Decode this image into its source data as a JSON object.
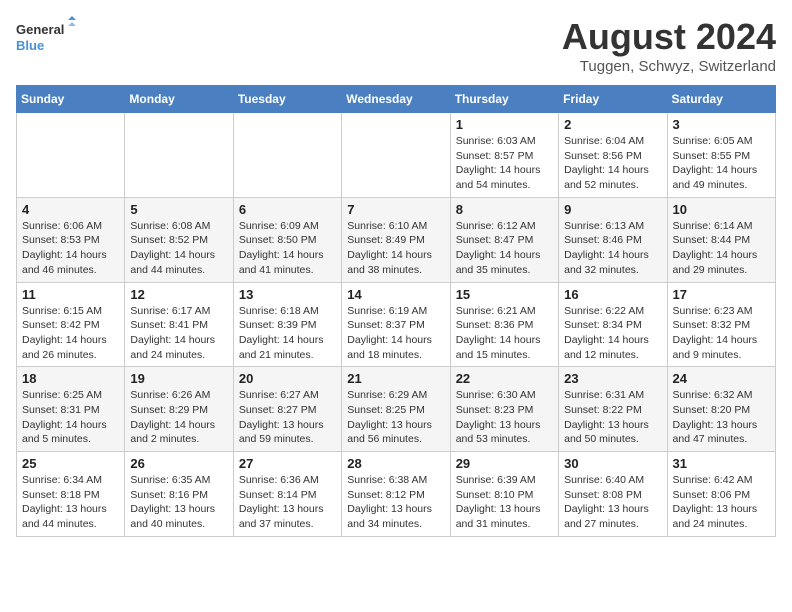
{
  "header": {
    "logo_line1": "General",
    "logo_line2": "Blue",
    "month": "August 2024",
    "location": "Tuggen, Schwyz, Switzerland"
  },
  "weekdays": [
    "Sunday",
    "Monday",
    "Tuesday",
    "Wednesday",
    "Thursday",
    "Friday",
    "Saturday"
  ],
  "weeks": [
    [
      {
        "day": "",
        "info": ""
      },
      {
        "day": "",
        "info": ""
      },
      {
        "day": "",
        "info": ""
      },
      {
        "day": "",
        "info": ""
      },
      {
        "day": "1",
        "info": "Sunrise: 6:03 AM\nSunset: 8:57 PM\nDaylight: 14 hours\nand 54 minutes."
      },
      {
        "day": "2",
        "info": "Sunrise: 6:04 AM\nSunset: 8:56 PM\nDaylight: 14 hours\nand 52 minutes."
      },
      {
        "day": "3",
        "info": "Sunrise: 6:05 AM\nSunset: 8:55 PM\nDaylight: 14 hours\nand 49 minutes."
      }
    ],
    [
      {
        "day": "4",
        "info": "Sunrise: 6:06 AM\nSunset: 8:53 PM\nDaylight: 14 hours\nand 46 minutes."
      },
      {
        "day": "5",
        "info": "Sunrise: 6:08 AM\nSunset: 8:52 PM\nDaylight: 14 hours\nand 44 minutes."
      },
      {
        "day": "6",
        "info": "Sunrise: 6:09 AM\nSunset: 8:50 PM\nDaylight: 14 hours\nand 41 minutes."
      },
      {
        "day": "7",
        "info": "Sunrise: 6:10 AM\nSunset: 8:49 PM\nDaylight: 14 hours\nand 38 minutes."
      },
      {
        "day": "8",
        "info": "Sunrise: 6:12 AM\nSunset: 8:47 PM\nDaylight: 14 hours\nand 35 minutes."
      },
      {
        "day": "9",
        "info": "Sunrise: 6:13 AM\nSunset: 8:46 PM\nDaylight: 14 hours\nand 32 minutes."
      },
      {
        "day": "10",
        "info": "Sunrise: 6:14 AM\nSunset: 8:44 PM\nDaylight: 14 hours\nand 29 minutes."
      }
    ],
    [
      {
        "day": "11",
        "info": "Sunrise: 6:15 AM\nSunset: 8:42 PM\nDaylight: 14 hours\nand 26 minutes."
      },
      {
        "day": "12",
        "info": "Sunrise: 6:17 AM\nSunset: 8:41 PM\nDaylight: 14 hours\nand 24 minutes."
      },
      {
        "day": "13",
        "info": "Sunrise: 6:18 AM\nSunset: 8:39 PM\nDaylight: 14 hours\nand 21 minutes."
      },
      {
        "day": "14",
        "info": "Sunrise: 6:19 AM\nSunset: 8:37 PM\nDaylight: 14 hours\nand 18 minutes."
      },
      {
        "day": "15",
        "info": "Sunrise: 6:21 AM\nSunset: 8:36 PM\nDaylight: 14 hours\nand 15 minutes."
      },
      {
        "day": "16",
        "info": "Sunrise: 6:22 AM\nSunset: 8:34 PM\nDaylight: 14 hours\nand 12 minutes."
      },
      {
        "day": "17",
        "info": "Sunrise: 6:23 AM\nSunset: 8:32 PM\nDaylight: 14 hours\nand 9 minutes."
      }
    ],
    [
      {
        "day": "18",
        "info": "Sunrise: 6:25 AM\nSunset: 8:31 PM\nDaylight: 14 hours\nand 5 minutes."
      },
      {
        "day": "19",
        "info": "Sunrise: 6:26 AM\nSunset: 8:29 PM\nDaylight: 14 hours\nand 2 minutes."
      },
      {
        "day": "20",
        "info": "Sunrise: 6:27 AM\nSunset: 8:27 PM\nDaylight: 13 hours\nand 59 minutes."
      },
      {
        "day": "21",
        "info": "Sunrise: 6:29 AM\nSunset: 8:25 PM\nDaylight: 13 hours\nand 56 minutes."
      },
      {
        "day": "22",
        "info": "Sunrise: 6:30 AM\nSunset: 8:23 PM\nDaylight: 13 hours\nand 53 minutes."
      },
      {
        "day": "23",
        "info": "Sunrise: 6:31 AM\nSunset: 8:22 PM\nDaylight: 13 hours\nand 50 minutes."
      },
      {
        "day": "24",
        "info": "Sunrise: 6:32 AM\nSunset: 8:20 PM\nDaylight: 13 hours\nand 47 minutes."
      }
    ],
    [
      {
        "day": "25",
        "info": "Sunrise: 6:34 AM\nSunset: 8:18 PM\nDaylight: 13 hours\nand 44 minutes."
      },
      {
        "day": "26",
        "info": "Sunrise: 6:35 AM\nSunset: 8:16 PM\nDaylight: 13 hours\nand 40 minutes."
      },
      {
        "day": "27",
        "info": "Sunrise: 6:36 AM\nSunset: 8:14 PM\nDaylight: 13 hours\nand 37 minutes."
      },
      {
        "day": "28",
        "info": "Sunrise: 6:38 AM\nSunset: 8:12 PM\nDaylight: 13 hours\nand 34 minutes."
      },
      {
        "day": "29",
        "info": "Sunrise: 6:39 AM\nSunset: 8:10 PM\nDaylight: 13 hours\nand 31 minutes."
      },
      {
        "day": "30",
        "info": "Sunrise: 6:40 AM\nSunset: 8:08 PM\nDaylight: 13 hours\nand 27 minutes."
      },
      {
        "day": "31",
        "info": "Sunrise: 6:42 AM\nSunset: 8:06 PM\nDaylight: 13 hours\nand 24 minutes."
      }
    ]
  ]
}
